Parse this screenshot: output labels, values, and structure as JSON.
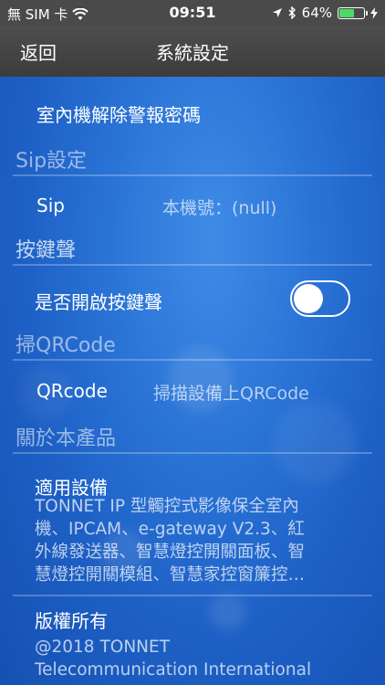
{
  "status": {
    "carrier": "無 SIM 卡",
    "time": "09:51",
    "battery_percent": "64%",
    "battery_level": 0.64
  },
  "nav": {
    "back_label": "返回",
    "title": "系統設定"
  },
  "items": {
    "disarm_password_label": "室內機解除警報密碼"
  },
  "sections": {
    "sip": "Sip設定",
    "keytone": "按鍵聲",
    "qrcode": "掃QRCode",
    "about": "關於本產品"
  },
  "sip": {
    "label": "Sip",
    "value": "本機號：(null)"
  },
  "keytone": {
    "label": "是否開啟按鍵聲",
    "enabled": false
  },
  "qrcode": {
    "label": "QRcode",
    "value": "掃描設備上QRCode"
  },
  "about": {
    "devices_title": "適用設備",
    "devices_text": "TONNET IP 型觸控式影像保全室內\n機、IPCAM、e-gateway V2.3、紅\n外線發送器、智慧燈控開關面板、智\n慧燈控開關模組、智慧家控窗簾控…",
    "copyright_title": "版權所有",
    "copyright_text": "@2018 TONNET\nTelecommunication International"
  }
}
